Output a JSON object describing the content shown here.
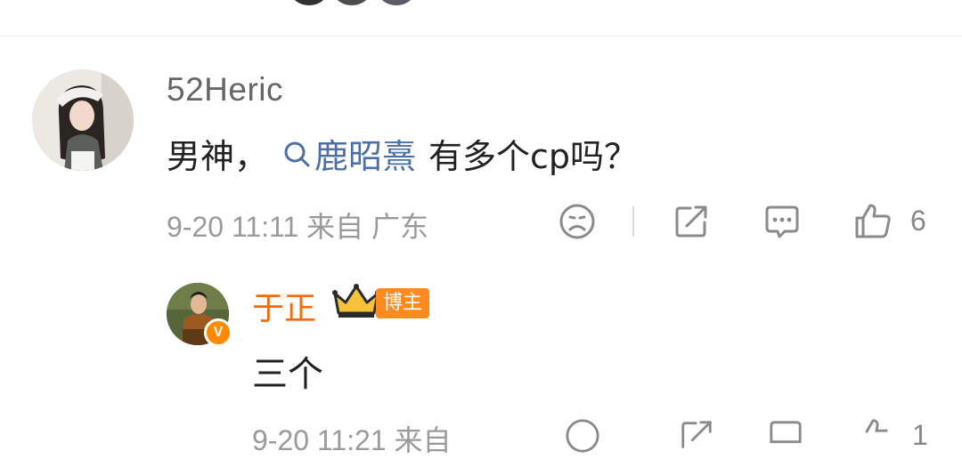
{
  "comment": {
    "username": "52Heric",
    "text_before": "男神，",
    "topic": "鹿昭熹",
    "text_after": "有多个cp吗？",
    "meta": "9-20 11:11  来自 广东",
    "likes": "6"
  },
  "reply": {
    "username": "于正",
    "badge": "博主",
    "text": "三个",
    "meta": "9-20 11:21  来自",
    "likes": "1"
  },
  "icons": [
    "sad-face-icon",
    "share-icon",
    "comment-icon",
    "thumbs-up-icon",
    "search-icon",
    "crown-icon",
    "verified-v-icon"
  ],
  "colors": {
    "link": "#4c6fa8",
    "author": "#f26a0e",
    "badge": "#ff8a1f",
    "muted": "#9a9a9a"
  }
}
